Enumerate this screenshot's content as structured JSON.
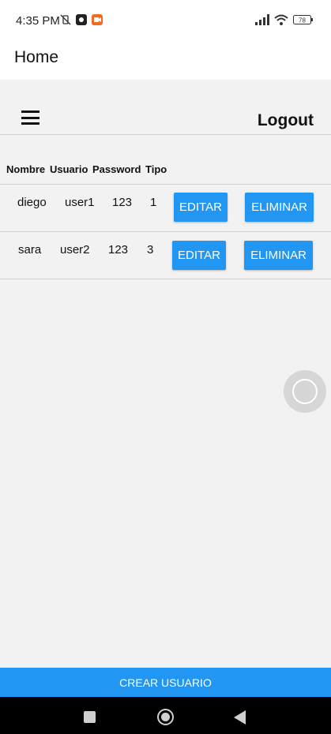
{
  "status_bar": {
    "time": "4:35 PM",
    "battery": "78",
    "left_icons": [
      "vibrate-off-icon",
      "app-notification-icon",
      "record-icon"
    ],
    "right_icons": [
      "signal-icon",
      "wifi-icon",
      "battery-icon"
    ]
  },
  "appbar": {
    "title": "Home"
  },
  "toolbar": {
    "logout_label": "Logout"
  },
  "table": {
    "headers": [
      "Nombre",
      "Usuario",
      "Password",
      "Tipo"
    ],
    "rows": [
      {
        "nombre": "diego",
        "usuario": "user1",
        "password": "123",
        "tipo": "1",
        "edit_label": "EDITAR",
        "delete_label": "ELIMINAR"
      },
      {
        "nombre": "sara",
        "usuario": "user2",
        "password": "123",
        "tipo": "3",
        "edit_label": "EDITAR",
        "delete_label": "ELIMINAR"
      }
    ]
  },
  "create_button": {
    "label": "CREAR USUARIO"
  },
  "colors": {
    "accent": "#2196f3",
    "background": "#f2f2f2"
  }
}
